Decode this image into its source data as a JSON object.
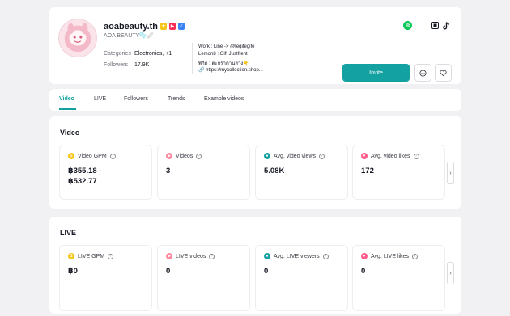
{
  "profile": {
    "handle": "aoabeauty.th",
    "nickname": "AOA BEAUTY🫧🩹",
    "categories_label": "Categories",
    "categories_value": "Electronics, +1",
    "followers_label": "Followers",
    "followers_value": "17.9K",
    "bio": [
      "Work : Line -> @fegifegife",
      "Lemon8 : Gift Justfrent",
      "พิกัด : ตะกร้าด้านล่าง👇",
      "🔗 https://mycollection.shop..."
    ],
    "invite_label": "Invite",
    "colors": {
      "accent": "#13A1A1",
      "line_green": "#06C755"
    }
  },
  "tabs": [
    {
      "label": "Video",
      "active": true
    },
    {
      "label": "LIVE"
    },
    {
      "label": "Followers"
    },
    {
      "label": "Trends"
    },
    {
      "label": "Example videos"
    }
  ],
  "video": {
    "title": "Video",
    "metrics": [
      {
        "label": "Video GPM",
        "value": "฿355.18 -\n฿532.77",
        "icon": "coin-icon"
      },
      {
        "label": "Videos",
        "value": "3",
        "icon": "play-icon"
      },
      {
        "label": "Avg. video views",
        "value": "5.08K",
        "icon": "eye-icon"
      },
      {
        "label": "Avg. video likes",
        "value": "172",
        "icon": "heart-icon"
      }
    ]
  },
  "live": {
    "title": "LIVE",
    "metrics": [
      {
        "label": "LIVE GPM",
        "value": "฿0",
        "icon": "coin-icon"
      },
      {
        "label": "LIVE videos",
        "value": "0",
        "icon": "play-icon"
      },
      {
        "label": "Avg. LIVE viewers",
        "value": "0",
        "icon": "eye-icon"
      },
      {
        "label": "Avg. LIVE likes",
        "value": "0",
        "icon": "heart-icon"
      }
    ]
  }
}
